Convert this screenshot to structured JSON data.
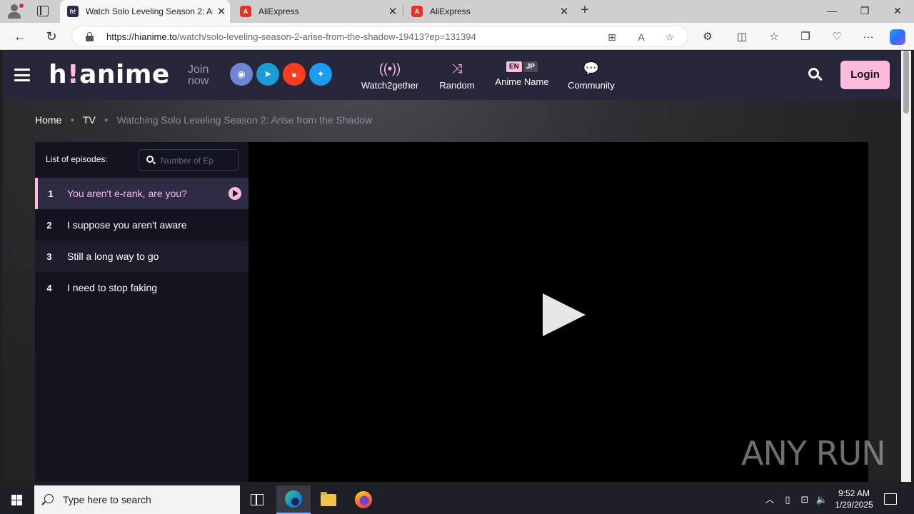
{
  "browser": {
    "tabs": [
      {
        "title": "Watch Solo Leveling Season 2: Ar",
        "favicon": "h!"
      },
      {
        "title": "AliExpress",
        "favicon": "A"
      },
      {
        "title": "AliExpress",
        "favicon": "A"
      }
    ],
    "url_domain": "https://hianime.to",
    "url_path": "/watch/solo-leveling-season-2-arise-from-the-shadow-19413?ep=131394"
  },
  "site": {
    "logo_main": "h",
    "logo_bang": "!",
    "logo_rest": "anime",
    "join_now": "Join now",
    "nav": [
      {
        "label": "Watch2gether",
        "icon": "broadcast-icon"
      },
      {
        "label": "Random",
        "icon": "shuffle-icon"
      },
      {
        "label": "Anime Name",
        "icon": "language-toggle"
      },
      {
        "label": "Community",
        "icon": "chat-icon"
      }
    ],
    "lang_en": "EN",
    "lang_jp": "JP",
    "login": "Login",
    "colors": {
      "accent": "#ffbade",
      "header": "#27263b",
      "panel": "#141420"
    }
  },
  "breadcrumb": {
    "home": "Home",
    "tv": "TV",
    "current": "Watching Solo Leveling Season 2: Arise from the Shadow"
  },
  "episodes": {
    "label": "List of episodes:",
    "search_placeholder": "Number of Ep",
    "items": [
      {
        "num": "1",
        "title": "You aren't e-rank, are you?"
      },
      {
        "num": "2",
        "title": "I suppose you aren't aware"
      },
      {
        "num": "3",
        "title": "Still a long way to go"
      },
      {
        "num": "4",
        "title": "I need to stop faking"
      }
    ]
  },
  "watermark": "ANY RUN",
  "taskbar": {
    "search_placeholder": "Type here to search",
    "time": "9:52 AM",
    "date": "1/29/2025"
  }
}
